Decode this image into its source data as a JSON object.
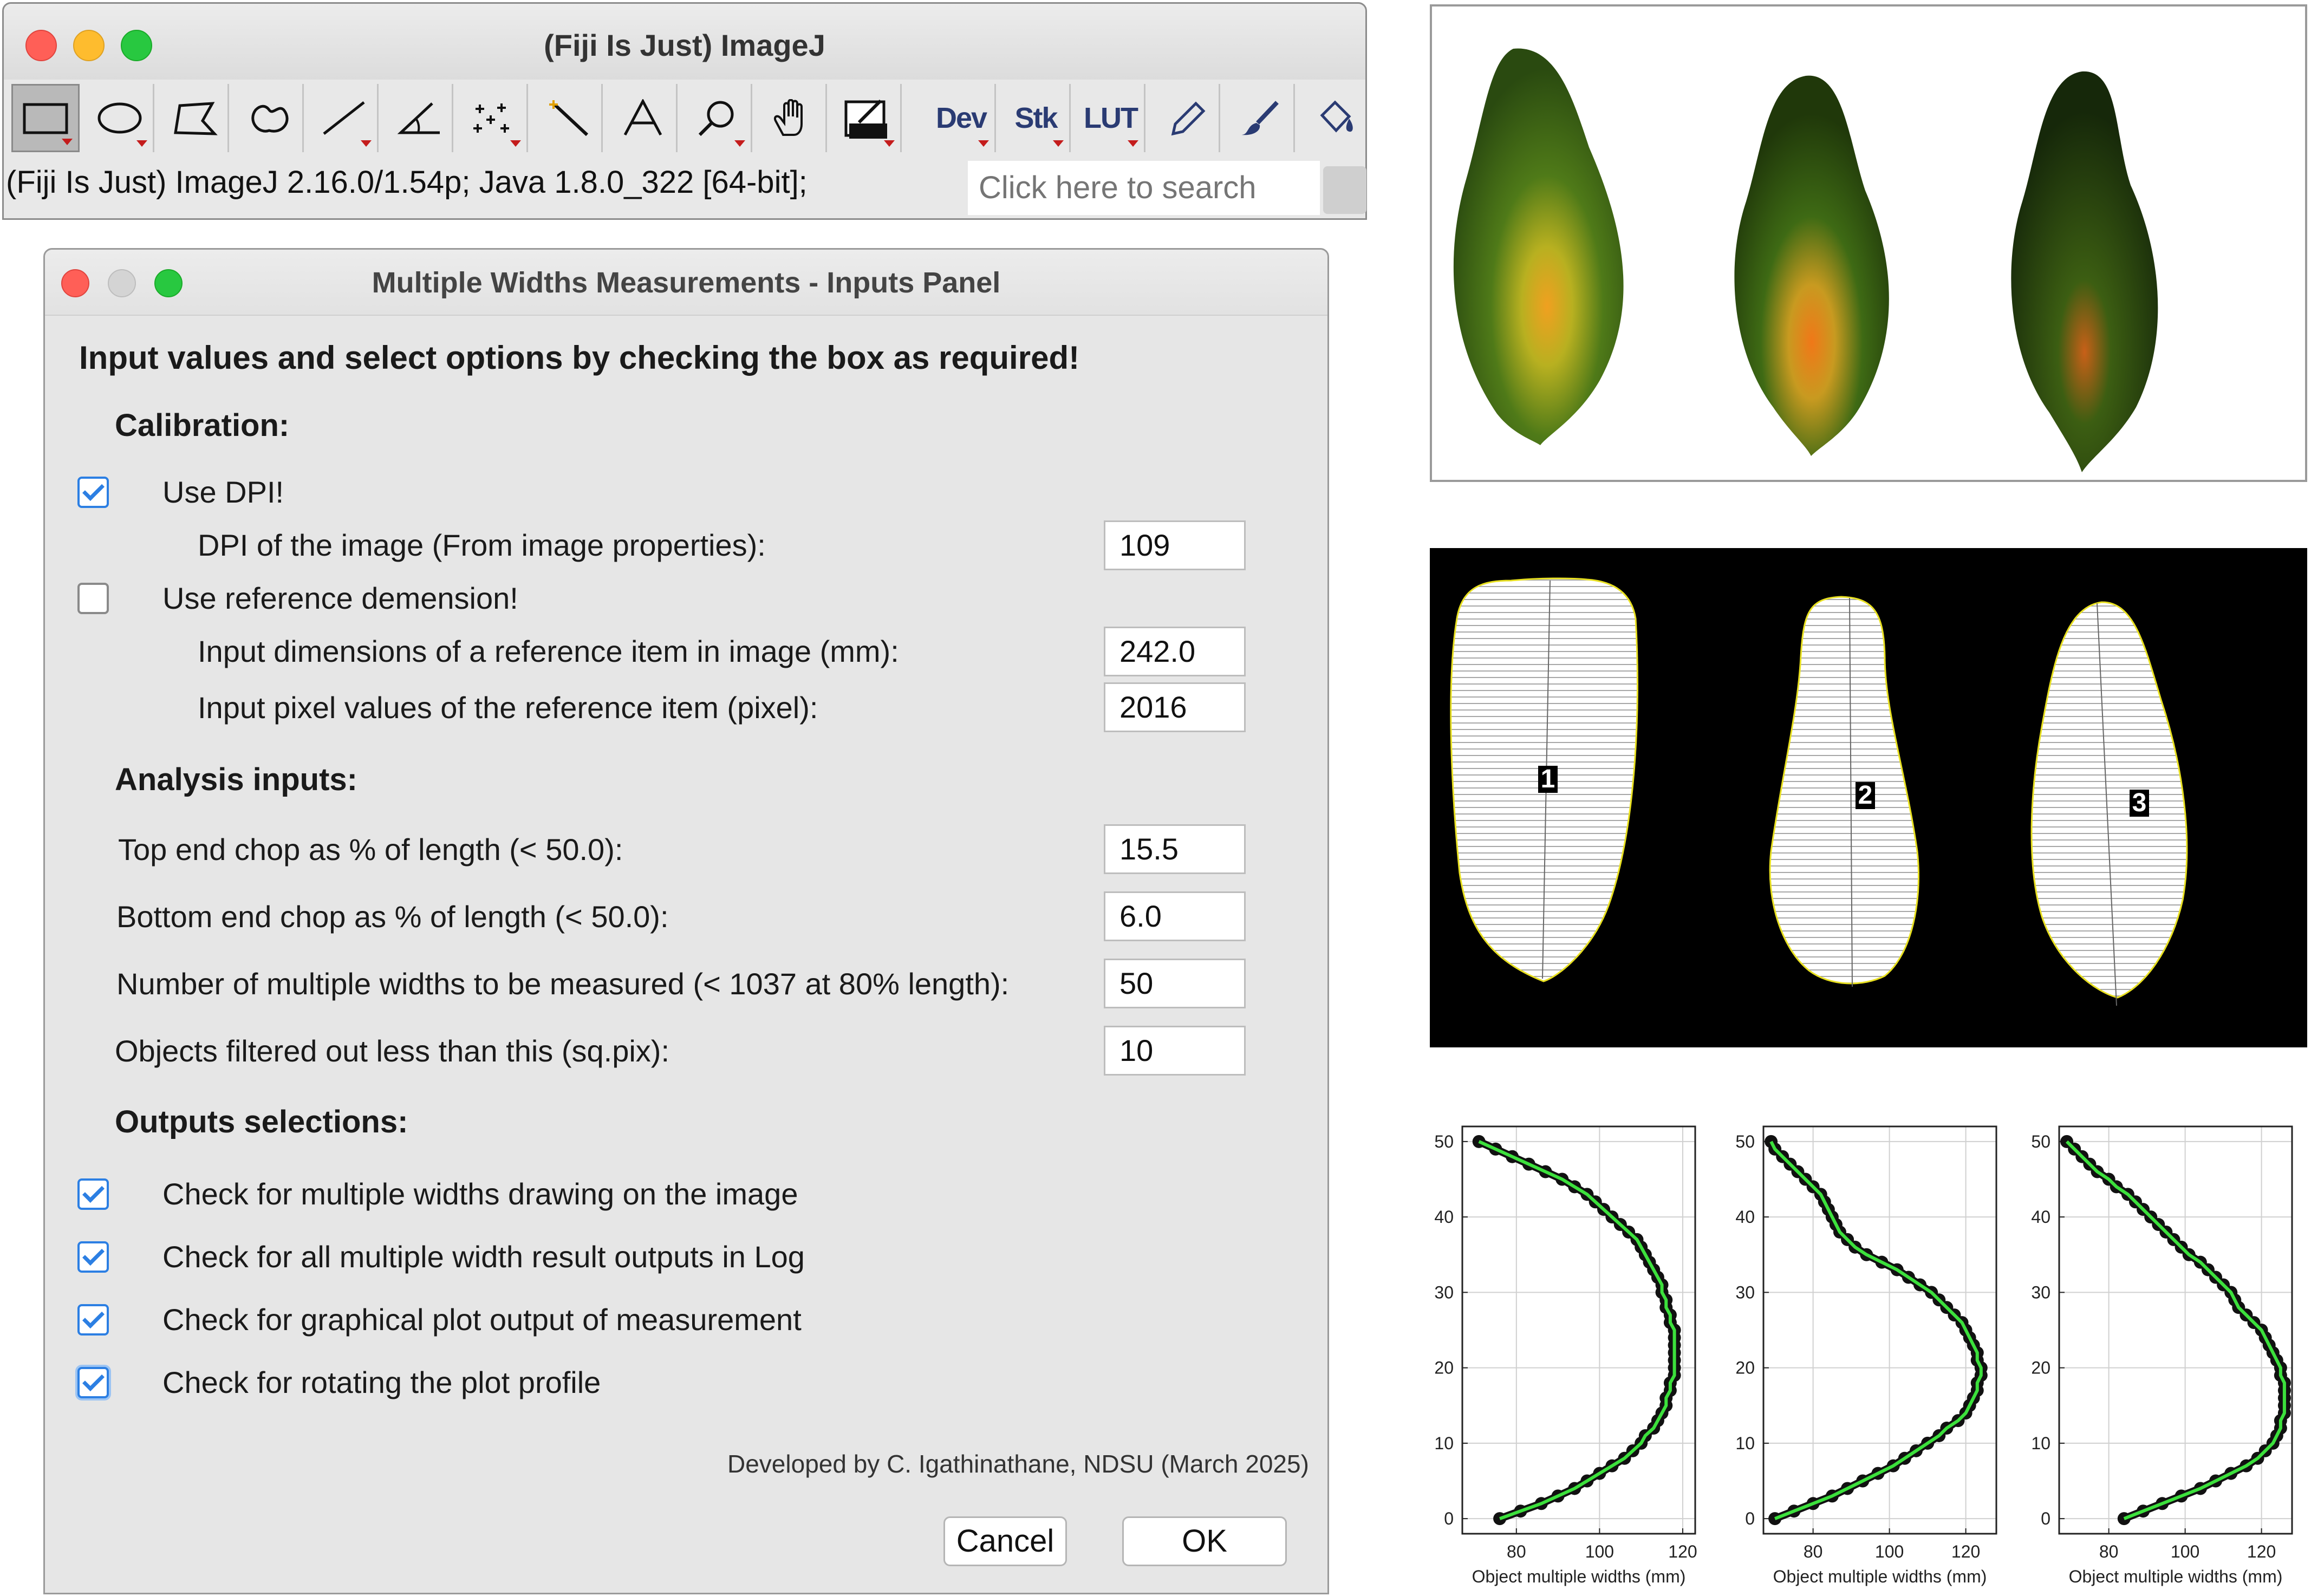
{
  "fiji": {
    "title": "(Fiji Is Just) ImageJ",
    "status": "(Fiji Is Just) ImageJ 2.16.0/1.54p; Java 1.8.0_322 [64-bit];",
    "search_placeholder": "Click here to search",
    "tools": [
      {
        "name": "rectangle-tool",
        "icon": "rectangle-icon"
      },
      {
        "name": "oval-tool",
        "icon": "oval-icon"
      },
      {
        "name": "polygon-tool",
        "icon": "polygon-icon"
      },
      {
        "name": "freehand-tool",
        "icon": "freehand-icon"
      },
      {
        "name": "line-tool",
        "icon": "line-icon"
      },
      {
        "name": "angle-tool",
        "icon": "angle-icon"
      },
      {
        "name": "multipoint-tool",
        "icon": "multipoint-icon"
      },
      {
        "name": "wand-tool",
        "icon": "magic-wand-icon"
      },
      {
        "name": "text-tool",
        "icon": "text-icon"
      },
      {
        "name": "zoom-tool",
        "icon": "magnifier-icon"
      },
      {
        "name": "hand-tool",
        "icon": "hand-icon"
      },
      {
        "name": "color-picker-tool",
        "icon": "color-picker-icon"
      },
      {
        "name": "dev-menu",
        "label": "Dev"
      },
      {
        "name": "stk-menu",
        "label": "Stk"
      },
      {
        "name": "lut-menu",
        "label": "LUT"
      },
      {
        "name": "pencil-tool",
        "icon": "pencil-icon"
      },
      {
        "name": "brush-tool",
        "icon": "brush-icon"
      },
      {
        "name": "flood-fill-tool",
        "icon": "paint-bucket-icon"
      }
    ]
  },
  "dialog": {
    "title": "Multiple Widths Measurements - Inputs Panel",
    "intro": "Input values and select options by checking the box as required!",
    "calibration_header": "Calibration:",
    "use_dpi_label": "Use DPI!",
    "use_dpi_checked": true,
    "dpi_label": "DPI of the image (From image properties):",
    "dpi_value": "109",
    "use_ref_label": "Use reference demension!",
    "use_ref_checked": false,
    "ref_dim_label": "Input dimensions of a reference item in image (mm):",
    "ref_dim_value": "242.0",
    "ref_pix_label": "Input pixel values of the reference item  (pixel):",
    "ref_pix_value": "2016",
    "analysis_header": "Analysis inputs:",
    "top_chop_label": "Top end chop as % of length (< 50.0):",
    "top_chop_value": "15.5",
    "bottom_chop_label": "Bottom end chop as % of length (< 50.0):",
    "bottom_chop_value": "6.0",
    "num_widths_label": "Number of multiple widths to be measured (< 1037 at 80% length):",
    "num_widths_value": "50",
    "filter_label": "Objects filtered out less than this (sq.pix):",
    "filter_value": "10",
    "outputs_header": "Outputs selections:",
    "out_drawing_label": "Check for multiple widths drawing on the image",
    "out_log_label": "Check for all multiple width result outputs in Log",
    "out_plot_label": "Check for graphical plot output of measurement",
    "out_rotate_label": "Check for rotating the plot profile",
    "credit": "Developed by C. Igathinathane, NDSU (March 2025)",
    "cancel_label": "Cancel",
    "ok_label": "OK"
  },
  "segmentation": {
    "labels": [
      "1",
      "2",
      "3"
    ]
  },
  "chart_data": [
    {
      "type": "line",
      "xlabel": "Object multiple widths (mm)",
      "ylabel": "",
      "xticks": [
        80,
        100,
        120
      ],
      "yticks": [
        0,
        10,
        20,
        30,
        40,
        50
      ],
      "xlim": [
        67,
        123
      ],
      "ylim": [
        -2,
        52
      ],
      "grid": true,
      "x": [
        76,
        81,
        86,
        90,
        94,
        97,
        100,
        103,
        106,
        108,
        110,
        111,
        113,
        114,
        115,
        116,
        116,
        117,
        117,
        118,
        118,
        118,
        118,
        118,
        118,
        118,
        117,
        117,
        116,
        116,
        115,
        115,
        114,
        113,
        112,
        111,
        110,
        109,
        107,
        105,
        103,
        101,
        99,
        97,
        94,
        91,
        87,
        83,
        79,
        75,
        71
      ],
      "y": [
        0,
        1,
        2,
        3,
        4,
        5,
        6,
        7,
        8,
        9,
        10,
        11,
        12,
        13,
        14,
        15,
        16,
        17,
        18,
        19,
        20,
        21,
        22,
        23,
        24,
        25,
        26,
        27,
        28,
        29,
        30,
        31,
        32,
        33,
        34,
        35,
        36,
        37,
        38,
        39,
        40,
        41,
        42,
        43,
        44,
        45,
        46,
        47,
        48,
        49,
        50
      ]
    },
    {
      "type": "line",
      "xlabel": "Object multiple widths (mm)",
      "ylabel": "",
      "xticks": [
        80,
        100,
        120
      ],
      "yticks": [
        0,
        10,
        20,
        30,
        40,
        50
      ],
      "xlim": [
        67,
        128
      ],
      "ylim": [
        -2,
        52
      ],
      "grid": true,
      "x": [
        70,
        75,
        80,
        85,
        89,
        93,
        97,
        101,
        104,
        107,
        110,
        113,
        115,
        118,
        120,
        121,
        122,
        123,
        123,
        124,
        124,
        123,
        123,
        122,
        121,
        120,
        119,
        117,
        115,
        113,
        111,
        108,
        105,
        102,
        98,
        94,
        91,
        89,
        87,
        86,
        85,
        84,
        83,
        82,
        80,
        78,
        76,
        74,
        72,
        70,
        69
      ],
      "y": [
        0,
        1,
        2,
        3,
        4,
        5,
        6,
        7,
        8,
        9,
        10,
        11,
        12,
        13,
        14,
        15,
        16,
        17,
        18,
        19,
        20,
        21,
        22,
        23,
        24,
        25,
        26,
        27,
        28,
        29,
        30,
        31,
        32,
        33,
        34,
        35,
        36,
        37,
        38,
        39,
        40,
        41,
        42,
        43,
        44,
        45,
        46,
        47,
        48,
        49,
        50
      ]
    },
    {
      "type": "line",
      "xlabel": "Object multiple widths (mm)",
      "ylabel": "",
      "xticks": [
        80,
        100,
        120
      ],
      "yticks": [
        0,
        10,
        20,
        30,
        40,
        50
      ],
      "xlim": [
        67,
        128
      ],
      "ylim": [
        -2,
        52
      ],
      "grid": true,
      "x": [
        84,
        89,
        94,
        99,
        104,
        108,
        112,
        116,
        119,
        121,
        123,
        124,
        125,
        125,
        126,
        126,
        126,
        126,
        126,
        125,
        125,
        124,
        123,
        122,
        121,
        120,
        118,
        116,
        114,
        113,
        112,
        110,
        108,
        106,
        104,
        101,
        99,
        97,
        95,
        93,
        91,
        89,
        87,
        85,
        82,
        80,
        77,
        75,
        73,
        71,
        69
      ],
      "y": [
        0,
        1,
        2,
        3,
        4,
        5,
        6,
        7,
        8,
        9,
        10,
        11,
        12,
        13,
        14,
        15,
        16,
        17,
        18,
        19,
        20,
        21,
        22,
        23,
        24,
        25,
        26,
        27,
        28,
        29,
        30,
        31,
        32,
        33,
        34,
        35,
        36,
        37,
        38,
        39,
        40,
        41,
        42,
        43,
        44,
        45,
        46,
        47,
        48,
        49,
        50
      ]
    }
  ]
}
